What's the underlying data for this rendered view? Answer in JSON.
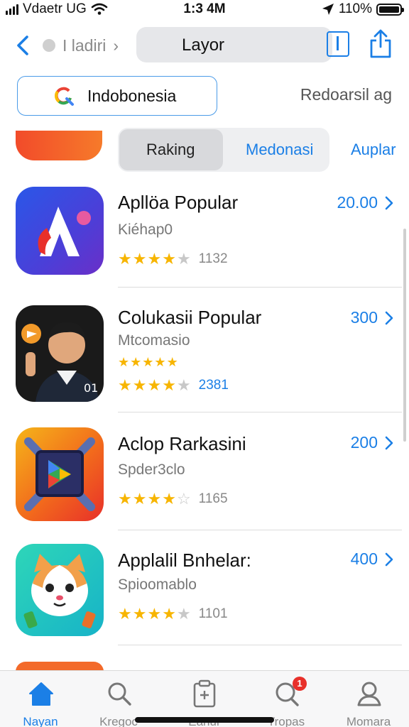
{
  "status_bar": {
    "carrier": "Vdaetr UG",
    "time": "1:3 4M",
    "battery": "110%",
    "battery_level": 1.0,
    "icons": [
      "signal-bars-icon",
      "wifi-icon",
      "location-arrow-icon",
      "battery-icon"
    ]
  },
  "nav": {
    "breadcrumb": "I ladiri",
    "title": "Layor",
    "icons": [
      "back-chevron-icon",
      "tabs-icon",
      "share-icon"
    ]
  },
  "search": {
    "value": "Indobonesia",
    "icon": "google-search-icon"
  },
  "recommend_label": "Redoarsil ag",
  "segments": {
    "items": [
      "Raking",
      "Medonasi",
      "Auplar"
    ],
    "selected": "Raking"
  },
  "apps": [
    {
      "name": "Apllöa Popular",
      "subtitle": "Kiéhap0",
      "rating": 4.5,
      "count": "1132",
      "price": "20.00",
      "icon": "letter-a-icon"
    },
    {
      "name": "Colukasii Popular",
      "subtitle": "Mtcomasio",
      "extra_stars": 5,
      "rating": 4.5,
      "count": "2381",
      "price": "300",
      "icon": "person-portrait-icon"
    },
    {
      "name": "Aclop Rarkasini",
      "subtitle": "Spder3clo",
      "rating": 4,
      "count": "1165",
      "price": "200",
      "icon": "play-store-icon"
    },
    {
      "name": "Applalil Bnhelar:",
      "subtitle": "Spioomablo",
      "rating": 4.5,
      "count": "1101",
      "price": "400",
      "icon": "cat-face-icon"
    }
  ],
  "tab_bar": {
    "tabs": [
      {
        "label": "Nayan",
        "icon": "home-icon",
        "active": true
      },
      {
        "label": "Kregoc",
        "icon": "search-icon",
        "active": false
      },
      {
        "label": "Eanul",
        "icon": "clipboard-icon",
        "active": false
      },
      {
        "label": "Tropas",
        "icon": "chat-search-icon",
        "active": false,
        "badge": "1"
      },
      {
        "label": "Momara",
        "icon": "profile-icon",
        "active": false
      }
    ]
  },
  "colors": {
    "accent": "#1b7fe6",
    "star": "#f7b500",
    "badge": "#e8302a"
  }
}
